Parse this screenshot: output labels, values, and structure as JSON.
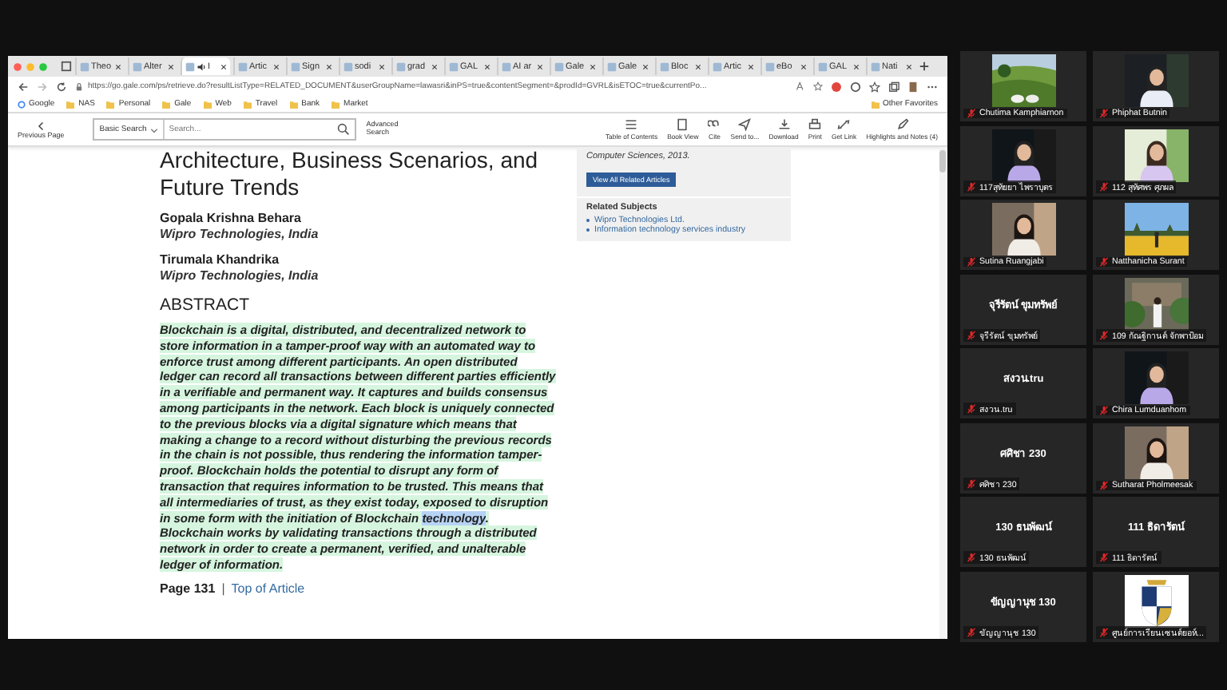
{
  "browser": {
    "tabs": [
      {
        "title": "Theo",
        "selected": false,
        "audio": false
      },
      {
        "title": "Alter",
        "selected": false,
        "audio": false
      },
      {
        "title": "I",
        "selected": true,
        "audio": true
      },
      {
        "title": "Artic",
        "selected": false,
        "audio": false
      },
      {
        "title": "Sign",
        "selected": false,
        "audio": false
      },
      {
        "title": "sodi",
        "selected": false,
        "audio": false
      },
      {
        "title": "grad",
        "selected": false,
        "audio": false
      },
      {
        "title": "GAL",
        "selected": false,
        "audio": false
      },
      {
        "title": "AI ar",
        "selected": false,
        "audio": false
      },
      {
        "title": "Gale",
        "selected": false,
        "audio": false
      },
      {
        "title": "Gale",
        "selected": false,
        "audio": false
      },
      {
        "title": "Bloc",
        "selected": false,
        "audio": false
      },
      {
        "title": "Artic",
        "selected": false,
        "audio": false
      },
      {
        "title": "eBo",
        "selected": false,
        "audio": false
      },
      {
        "title": "GAL",
        "selected": false,
        "audio": false
      },
      {
        "title": "Nati",
        "selected": false,
        "audio": false
      }
    ],
    "url": "https://go.gale.com/ps/retrieve.do?resultListType=RELATED_DOCUMENT&userGroupName=lawasri&inPS=true&contentSegment=&prodId=GVRL&isETOC=true&currentPo...",
    "bookmarks": [
      "Google",
      "NAS",
      "Personal",
      "Gale",
      "Web",
      "Travel",
      "Bank",
      "Market"
    ],
    "other_bookmarks": "Other Favorites",
    "toolbar": {
      "back_label": "Previous Page",
      "search_scope": "Basic Search",
      "search_placeholder": "Search...",
      "advanced_label": "Advanced Search",
      "tools": [
        "Table of Contents",
        "Book View",
        "Cite",
        "Send to...",
        "Download",
        "Print",
        "Get Link",
        "Highlights and Notes (4)"
      ]
    }
  },
  "article": {
    "title_lines": [
      "Architecture, Business Scenarios, and",
      "Future Trends"
    ],
    "authors": [
      {
        "name": "Gopala Krishna Behara",
        "affiliation": "Wipro Technologies, India"
      },
      {
        "name": "Tirumala Khandrika",
        "affiliation": "Wipro Technologies, India"
      }
    ],
    "abstract_heading": "ABSTRACT",
    "abstract": {
      "text_before": "Blockchain is a digital, distributed, and decentralized network to store information in a tamper-proof way with an automated way to enforce trust among different participants. An open distributed ledger can record all transactions between different parties efficiently in a verifiable and permanent way. It captures and builds consensus among participants in the network. Each block is uniquely connected to the previous blocks via a digital signature which means that making a change to a record without disturbing the previous records in the chain is not possible, thus rendering the information tamper-proof. Blockchain holds the potential to disrupt any form of transaction that requires information to be trusted. This means that all intermediaries of trust, as they exist today, exposed to disruption in some form with the initiation of Blockchain ",
      "selection": "technology",
      "text_after": ". Blockchain works by validating transactions through a distributed network in order to create a permanent, verified, and unalterable ledger of information."
    },
    "page_label": "Page 131",
    "separator": "|",
    "top_link": "Top of Article"
  },
  "sidebar": {
    "source": "Computer Sciences, 2013.",
    "view_all_button": "View All Related Articles",
    "subjects_heading": "Related Subjects",
    "subjects": [
      "Wipro Technologies Ltd.",
      "Information technology services industry"
    ]
  },
  "participants": [
    {
      "kind": "picture",
      "label": "Chutima Kamphiarnon",
      "muted": true
    },
    {
      "kind": "picture",
      "label": "Phiphat Butnin",
      "muted": true
    },
    {
      "kind": "picture",
      "label": "117สุทัยยา ไพราบุตร",
      "muted": true
    },
    {
      "kind": "picture",
      "label": "112 สุทัศพร ศุภผล",
      "muted": true
    },
    {
      "kind": "picture",
      "label": "Sutina Ruangjabi",
      "muted": true
    },
    {
      "kind": "picture",
      "label": "Natthanicha Surant",
      "muted": true
    },
    {
      "kind": "name",
      "display_name": "จุรีรัตน์ ขุมทรัพย์",
      "label": "จุรีรัตน์ ขุมทรัพย์",
      "muted": true
    },
    {
      "kind": "picture",
      "label": "109 กัณฐิกานต์ จักพาป้อม",
      "muted": true
    },
    {
      "kind": "name",
      "display_name": "สงวน.tru",
      "label": "สงวน.tru",
      "muted": true
    },
    {
      "kind": "picture",
      "label": "Chira Lumduanhom",
      "muted": true
    },
    {
      "kind": "name",
      "display_name": "ศศิชา 230",
      "label": "ศศิชา 230",
      "muted": true
    },
    {
      "kind": "picture",
      "label": "Sutharat Pholmeesak",
      "muted": true
    },
    {
      "kind": "name",
      "display_name": "130 ธนพัฒน์",
      "label": "130 ธนพัฒน์",
      "muted": true
    },
    {
      "kind": "name",
      "display_name": "111 ธิดารัตน์",
      "label": "111 ธิดารัตน์",
      "muted": true
    },
    {
      "kind": "name",
      "display_name": "ขัญญานุช 130",
      "label": "ขัญญานุช 130",
      "muted": true
    },
    {
      "kind": "picture",
      "label": "ศูนย์การเรียนเซนต์ยอห์...",
      "muted": true
    }
  ]
}
